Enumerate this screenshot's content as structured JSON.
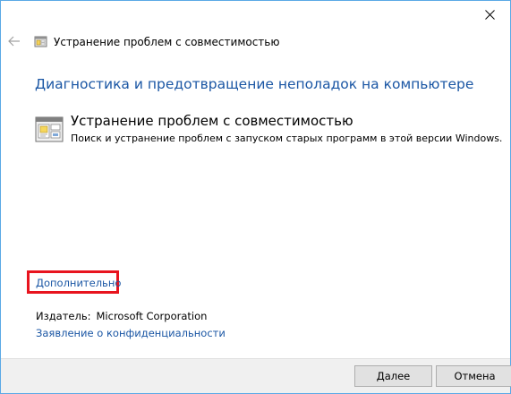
{
  "window": {
    "title": "Устранение проблем с совместимостью",
    "close_icon": "close-icon",
    "back_icon": "back-arrow-icon"
  },
  "content": {
    "heading": "Диагностика и предотвращение неполадок на компьютере",
    "task": {
      "title": "Устранение проблем с совместимостью",
      "description": "Поиск и устранение проблем с запуском старых программ в этой версии Windows.",
      "icon": "compatibility-troubleshooter-icon"
    },
    "advanced_link": "Дополнительно",
    "publisher_label": "Издатель:",
    "publisher_value": "Microsoft Corporation",
    "privacy_link": "Заявление о конфиденциальности"
  },
  "footer": {
    "next_label": "Далее",
    "cancel_label": "Отмена"
  },
  "colors": {
    "link": "#1a56a4",
    "highlight": "#e8141e",
    "window_border": "#5aa9e6",
    "footer_bg": "#f0f0f0"
  }
}
